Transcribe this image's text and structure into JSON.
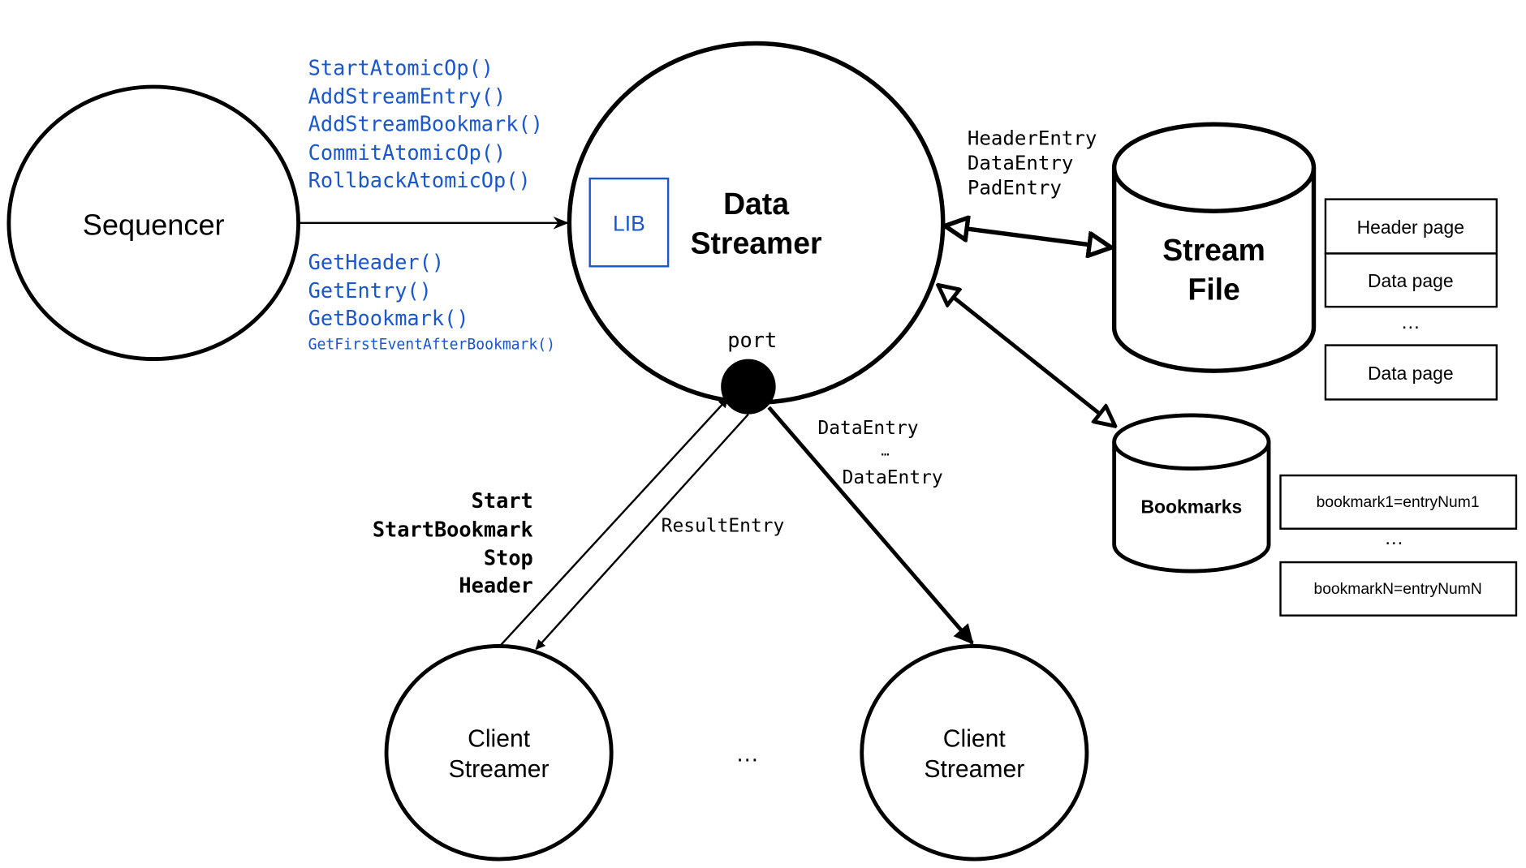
{
  "colors": {
    "api_blue": "#1a56cc",
    "stroke": "#000000",
    "background": "#ffffff"
  },
  "nodes": {
    "sequencer": "Sequencer",
    "data_streamer": [
      "Data",
      "Streamer"
    ],
    "lib": "LIB",
    "port": "port",
    "stream_file": [
      "Stream",
      "File"
    ],
    "bookmarks": "Bookmarks",
    "client_streamer_1": [
      "Client",
      "Streamer"
    ],
    "client_streamer_2": [
      "Client",
      "Streamer"
    ],
    "clients_ellipsis": "…"
  },
  "sequencer_write_api": [
    "StartAtomicOp()",
    "AddStreamEntry()",
    "AddStreamBookmark()",
    "CommitAtomicOp()",
    "RollbackAtomicOp()"
  ],
  "sequencer_read_api": [
    "GetHeader()",
    "GetEntry()",
    "GetBookmark()",
    "GetFirstEventAfterBookmark()"
  ],
  "stream_file_entries": [
    "HeaderEntry",
    "DataEntry",
    "PadEntry"
  ],
  "stream_file_pages": {
    "items": [
      "Header page",
      "Data page",
      "Data page"
    ],
    "ellipsis": "…"
  },
  "bookmark_records": {
    "items": [
      "bookmark1=entryNum1",
      "bookmarkN=entryNumN"
    ],
    "ellipsis": "…"
  },
  "client_commands": [
    "Start",
    "StartBookmark",
    "Stop",
    "Header"
  ],
  "client_result_label": "ResultEntry",
  "data_stream_labels": [
    "DataEntry",
    "…",
    "DataEntry"
  ]
}
